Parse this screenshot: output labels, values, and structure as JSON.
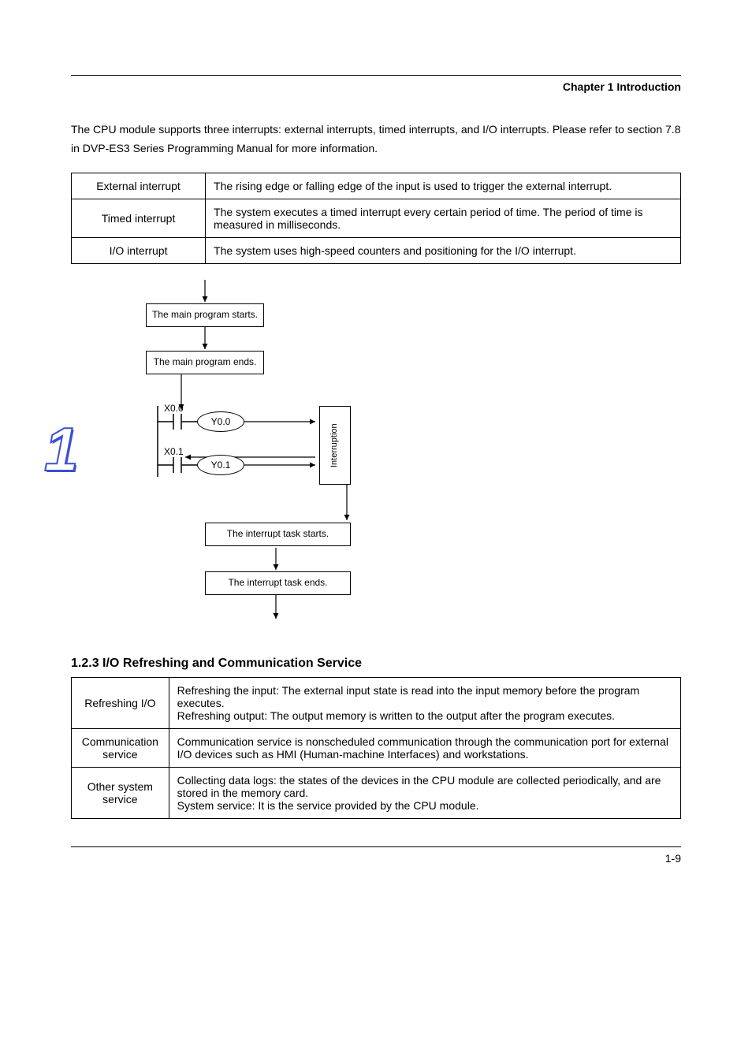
{
  "chapter_title": "Chapter 1 Introduction",
  "intro_para": "The CPU module supports three interrupts: external interrupts, timed interrupts, and I/O interrupts. Please refer to section 7.8 in DVP-ES3 Series Programming Manual for more information.",
  "table1": {
    "rows": [
      {
        "c1": "External interrupt",
        "c2": "The rising edge or falling edge of the input is used to trigger the external interrupt."
      },
      {
        "c1": "Timed interrupt",
        "c2": "The system executes a timed interrupt every certain period of time. The period of time is measured in milliseconds."
      },
      {
        "c1": "I/O interrupt",
        "c2": "The system uses high-speed counters and positioning for the I/O interrupt."
      }
    ]
  },
  "flow": {
    "main_start": "The main program starts.",
    "main_end": "The main program ends.",
    "int_start": "The interrupt task starts.",
    "int_end": "The interrupt task ends.",
    "interruption": "Interruption",
    "contact_row1": {
      "x": "X0.0",
      "y": "Y0.0"
    },
    "contact_row2": {
      "x": "X0.1",
      "y": "Y0.1"
    }
  },
  "section_head": "1.2.3 I/O Refreshing and Communication Service",
  "refresh_table": {
    "rows": [
      {
        "c1": "Refreshing I/O",
        "c2": "Refreshing the input: The external input state is read into the input memory before the program executes.\nRefreshing output: The output memory is written to the output after the program executes."
      },
      {
        "c1": "Communication service",
        "c2": "Communication service is nonscheduled communication through the communication port for external I/O devices such as HMI (Human-machine Interfaces) and workstations."
      },
      {
        "c1": "Other system service",
        "c2": "Collecting data logs: the states of the devices in the CPU module are collected periodically, and are stored in the memory card.\nSystem service: It is the service provided by the CPU module."
      }
    ]
  },
  "footer_page": "1-9",
  "big_number": "1"
}
